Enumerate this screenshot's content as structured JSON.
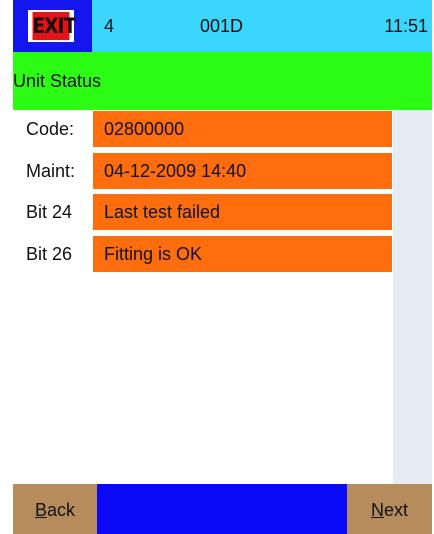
{
  "topbar": {
    "exit_label": "EXIT",
    "number": "4",
    "unit_id": "001D",
    "time": "11:51"
  },
  "title": "Unit Status",
  "rows": [
    {
      "label": "Code:",
      "value": "02800000"
    },
    {
      "label": "Maint:",
      "value": "04-12-2009 14:40"
    },
    {
      "label": "Bit 24",
      "value": "Last test failed"
    },
    {
      "label": "Bit 26",
      "value": "Fitting is OK"
    }
  ],
  "bottombar": {
    "back_hotkey": "B",
    "back_rest": "ack",
    "next_hotkey": "N",
    "next_rest": "ext"
  },
  "colors": {
    "topbar": "#3ad6fb",
    "exit_button": "#1515ee",
    "exit_sign": "#e1141a",
    "titlebar": "#2cfc14",
    "value_field": "#fd6d0d",
    "side_column": "#e6ecf4",
    "nav_button": "#b68c5d",
    "nav_middle": "#0b0af7"
  },
  "icons": {
    "exit": "exit-sign-icon"
  }
}
